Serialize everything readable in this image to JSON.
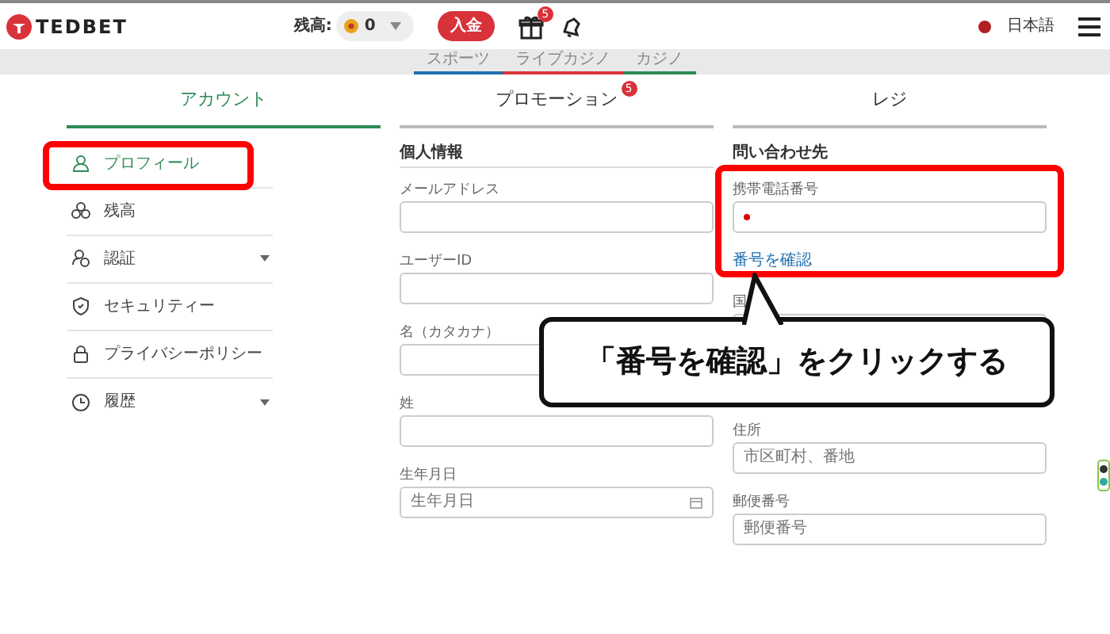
{
  "header": {
    "logo": "TEDBET",
    "balance_label": "残高:",
    "balance": "0",
    "deposit_button": "入金",
    "gift_badge": "5",
    "language": "日本語"
  },
  "subnav": [
    {
      "label": "スポーツ",
      "color": "#1f6fb0"
    },
    {
      "label": "ライブカジノ",
      "color": "#d8323a"
    },
    {
      "label": "カジノ",
      "color": "#2e8b57"
    }
  ],
  "tabs": [
    {
      "label": "アカウント",
      "selected": true
    },
    {
      "label": "プロモーション",
      "selected": false,
      "badge": "5"
    },
    {
      "label": "レジ",
      "selected": false
    }
  ],
  "sidebar": {
    "items": [
      {
        "label": "プロフィール",
        "kind": "user",
        "selected": true,
        "expandable": false,
        "highlighted": true
      },
      {
        "label": "残高",
        "kind": "coins",
        "selected": false,
        "expandable": false,
        "highlighted": false
      },
      {
        "label": "認証",
        "kind": "verify",
        "selected": false,
        "expandable": true,
        "highlighted": false
      },
      {
        "label": "セキュリティー",
        "kind": "shield",
        "selected": false,
        "expandable": false,
        "highlighted": false
      },
      {
        "label": "プライバシーポリシー",
        "kind": "lock",
        "selected": false,
        "expandable": false,
        "highlighted": false
      },
      {
        "label": "履歴",
        "kind": "clock",
        "selected": false,
        "expandable": true,
        "highlighted": false
      }
    ]
  },
  "personal": {
    "title": "個人情報",
    "fields": [
      {
        "label": "メールアドレス",
        "kind": "text"
      },
      {
        "label": "ユーザーID",
        "kind": "text"
      },
      {
        "label": "名（カタカナ）",
        "kind": "text"
      },
      {
        "label": "姓",
        "kind": "text"
      },
      {
        "label": "生年月日",
        "kind": "date",
        "placeholder": "生年月日"
      }
    ]
  },
  "contact": {
    "title": "問い合わせ先",
    "fields": [
      {
        "label": "携帯電話番号",
        "kind": "phone",
        "link": "番号を確認",
        "highlighted": true
      },
      {
        "label": "国",
        "kind": "select"
      },
      {
        "label": "住所",
        "kind": "text",
        "placeholder": "市区町村、番地"
      },
      {
        "label": "郵便番号",
        "kind": "text",
        "placeholder": "郵便番号"
      }
    ]
  },
  "callout": {
    "text": "「番号を確認」をクリックする"
  }
}
